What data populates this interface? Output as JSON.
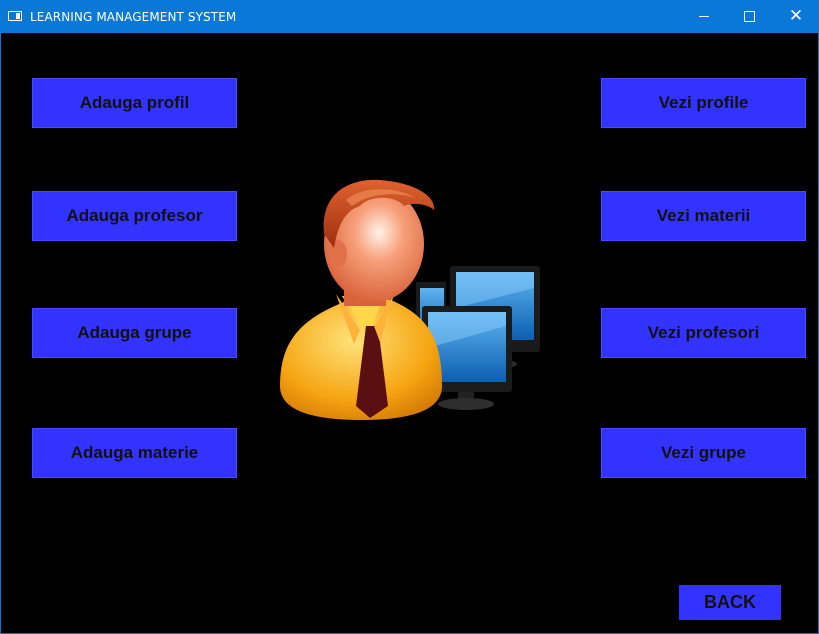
{
  "window": {
    "title": "LEARNING MANAGEMENT SYSTEM",
    "minimize_glyph": "",
    "maximize_glyph": "",
    "close_glyph": "✕"
  },
  "left_buttons": [
    {
      "label": "Adauga profil"
    },
    {
      "label": "Adauga profesor"
    },
    {
      "label": "Adauga grupe"
    },
    {
      "label": "Adauga materie"
    }
  ],
  "right_buttons": [
    {
      "label": "Vezi profile"
    },
    {
      "label": "Vezi materii"
    },
    {
      "label": "Vezi profesori"
    },
    {
      "label": "Vezi grupe"
    }
  ],
  "back_button": {
    "label": "BACK"
  },
  "hero_image": {
    "icon": "admin-user-with-computers-icon"
  },
  "colors": {
    "titlebar": "#0a78d7",
    "background": "#000000",
    "button": "#3333ff",
    "button_text": "#111111"
  }
}
